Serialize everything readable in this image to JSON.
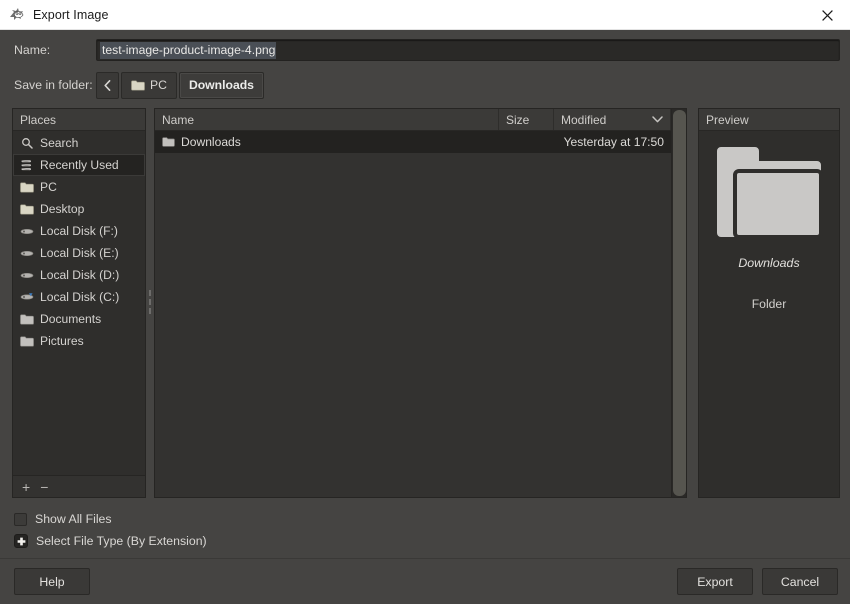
{
  "window": {
    "title": "Export Image",
    "icon": "gimp-wilber-icon",
    "close_label": "✕"
  },
  "name_field": {
    "label": "Name:",
    "value": "test-image-product-image-4.png",
    "selected": true
  },
  "folder_field": {
    "label": "Save in folder:",
    "back_icon": "chevron-left-icon",
    "crumbs": [
      {
        "label": "PC",
        "icon": "folder-icon",
        "active": false
      },
      {
        "label": "Downloads",
        "icon": "",
        "active": true
      }
    ]
  },
  "places": {
    "header": "Places",
    "items": [
      {
        "label": "Search",
        "icon": "search-icon",
        "selected": false
      },
      {
        "label": "Recently Used",
        "icon": "recent-icon",
        "selected": true
      },
      {
        "label": "PC",
        "icon": "folder-icon",
        "selected": false
      },
      {
        "label": "Desktop",
        "icon": "folder-icon",
        "selected": false
      },
      {
        "label": "Local Disk (F:)",
        "icon": "drive-icon",
        "selected": false
      },
      {
        "label": "Local Disk (E:)",
        "icon": "drive-icon",
        "selected": false
      },
      {
        "label": "Local Disk (D:)",
        "icon": "drive-icon",
        "selected": false
      },
      {
        "label": "Local Disk (C:)",
        "icon": "drive-system-icon",
        "selected": false
      },
      {
        "label": "Documents",
        "icon": "folder-gray-icon",
        "selected": false
      },
      {
        "label": "Pictures",
        "icon": "folder-gray-icon",
        "selected": false
      }
    ],
    "add_label": "+",
    "remove_label": "−"
  },
  "file_list": {
    "columns": {
      "name": "Name",
      "size": "Size",
      "modified": "Modified",
      "sort_icon": "chevron-down-icon"
    },
    "rows": [
      {
        "name": "Downloads",
        "icon": "folder-gray-icon",
        "size": "",
        "modified": "Yesterday at 17:50",
        "selected": true
      }
    ]
  },
  "preview": {
    "header": "Preview",
    "icon": "folder-large-icon",
    "name": "Downloads",
    "type": "Folder"
  },
  "options": {
    "show_all_files": {
      "label": "Show All Files",
      "checked": false
    },
    "select_file_type": {
      "label": "Select File Type (By Extension)",
      "expanded": false
    }
  },
  "footer": {
    "help": "Help",
    "export": "Export",
    "cancel": "Cancel"
  },
  "colors": {
    "dialog_bg": "#454442",
    "panel_bg": "#2f2e2c",
    "list_bg": "#333230",
    "row_selected": "#232220",
    "text": "#d5d3d0",
    "titlebar_bg": "#ffffff",
    "selection": "#4a4f56"
  }
}
